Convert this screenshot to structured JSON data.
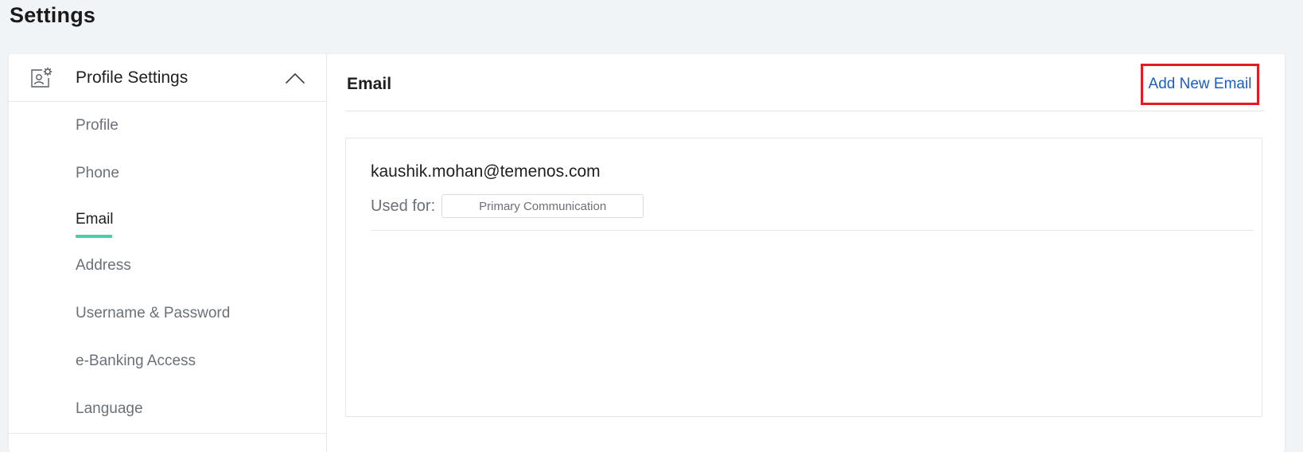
{
  "page": {
    "title": "Settings"
  },
  "sidebar": {
    "section_label": "Profile Settings",
    "section_icon": "profile-settings-icon",
    "toggle_icon": "chevron-up-icon",
    "items": [
      {
        "label": "Profile",
        "active": false
      },
      {
        "label": "Phone",
        "active": false
      },
      {
        "label": "Email",
        "active": true
      },
      {
        "label": "Address",
        "active": false
      },
      {
        "label": "Username & Password",
        "active": false
      },
      {
        "label": "e-Banking Access",
        "active": false
      },
      {
        "label": "Language",
        "active": false
      }
    ]
  },
  "main": {
    "title": "Email",
    "add_button_label": "Add New Email",
    "emails": [
      {
        "address": "kaushik.mohan@temenos.com",
        "used_for_label": "Used for:",
        "used_for_value": "Primary Communication"
      }
    ]
  },
  "colors": {
    "accent": "#3fd3a6",
    "link": "#1c5fbf",
    "highlight_border": "#e01d25",
    "background": "#f1f4f7"
  }
}
